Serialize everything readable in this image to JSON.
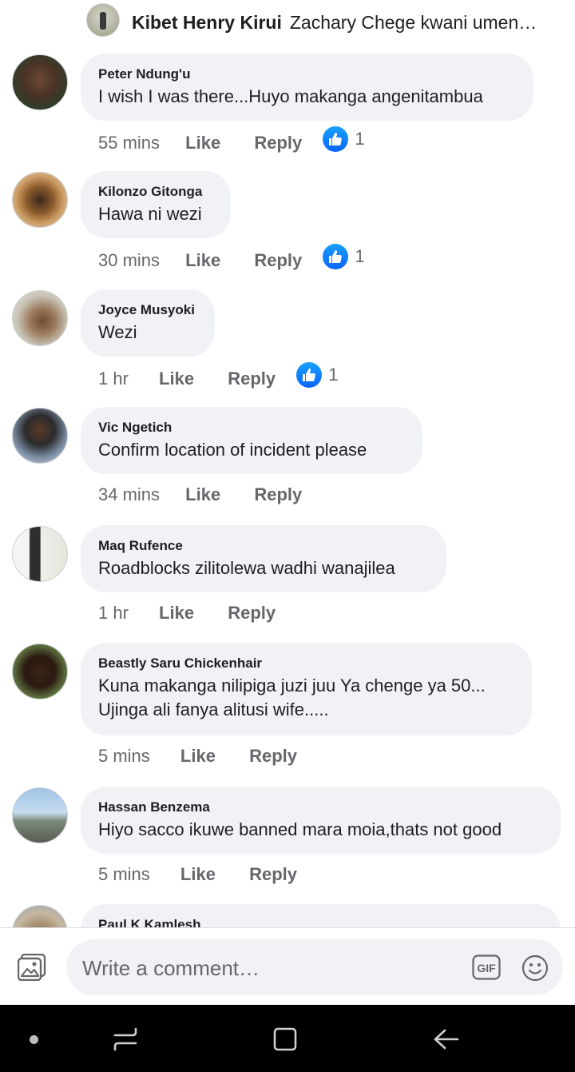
{
  "top_reply": {
    "author": "Kibet Henry Kirui",
    "text": "Zachary Chege kwani umen…"
  },
  "comments": [
    {
      "author": "Peter Ndung'u",
      "text": "I wish I was there...Huyo makanga angenitambua",
      "time": "55 mins",
      "like_label": "Like",
      "reply_label": "Reply",
      "reactions": "1"
    },
    {
      "author": "Kilonzo Gitonga",
      "text": "Hawa ni wezi",
      "time": "30 mins",
      "like_label": "Like",
      "reply_label": "Reply",
      "reactions": "1"
    },
    {
      "author": "Joyce Musyoki",
      "text": "Wezi",
      "time": "1 hr",
      "like_label": "Like",
      "reply_label": "Reply",
      "reactions": "1"
    },
    {
      "author": "Vic Ngetich",
      "text": "Confirm location  of incident please",
      "time": "34 mins",
      "like_label": "Like",
      "reply_label": "Reply"
    },
    {
      "author": "Maq Rufence",
      "text": "Roadblocks zilitolewa wadhi wanajilea",
      "time": "1 hr",
      "like_label": "Like",
      "reply_label": "Reply"
    },
    {
      "author": "Beastly Saru Chickenhair",
      "text_line1": "Kuna makanga nilipiga juzi juu Ya chenge ya 50...",
      "text_line2": "Ujinga ali fanya alitusi wife.....",
      "time": "5 mins",
      "like_label": "Like",
      "reply_label": "Reply"
    },
    {
      "author": "Hassan Benzema",
      "text": "Hiyo sacco ikuwe banned mara moia,thats not good",
      "time": "5 mins",
      "like_label": "Like",
      "reply_label": "Reply"
    },
    {
      "author": "Paul K Kamlesh"
    }
  ],
  "composer": {
    "placeholder": "Write a comment…",
    "gif_label": "GIF"
  },
  "icons": {
    "photo": "photo-icon",
    "gif": "gif-icon",
    "emoji": "emoji-icon",
    "like_reaction": "like-reaction-icon",
    "nav_recent": "recent-apps-icon",
    "nav_home": "home-icon",
    "nav_back": "back-icon"
  },
  "colors": {
    "bubble": "#f0f2f5",
    "like_blue": "#1877f2",
    "secondary_text": "#65676b",
    "navbar": "#000000"
  }
}
